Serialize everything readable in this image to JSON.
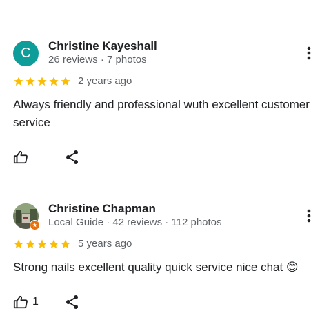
{
  "reviews": [
    {
      "author": "Christine Kayeshall",
      "avatar_letter": "C",
      "avatar_color": "#0f9d9a",
      "meta": "26 reviews · 7 photos",
      "rating": 5,
      "date": "2 years ago",
      "text": "Always friendly and professional wuth excellent customer service",
      "like_count": "",
      "icons": {
        "menu": "more-vert-icon",
        "like": "thumbs-up-icon",
        "share": "share-icon"
      }
    },
    {
      "author": "Christine Chapman",
      "avatar_type": "photo",
      "meta": "Local Guide · 42 reviews · 112 photos",
      "rating": 5,
      "date": "5 years ago",
      "text": "Strong nails excellent quality quick service nice chat 😊",
      "like_count": "1",
      "icons": {
        "menu": "more-vert-icon",
        "like": "thumbs-up-icon",
        "share": "share-icon",
        "badge": "local-guide-badge-icon"
      }
    }
  ],
  "colors": {
    "star": "#fbbc04",
    "divider": "#dadce0",
    "meta_text": "#5f6368",
    "badge": "#e8710a"
  }
}
